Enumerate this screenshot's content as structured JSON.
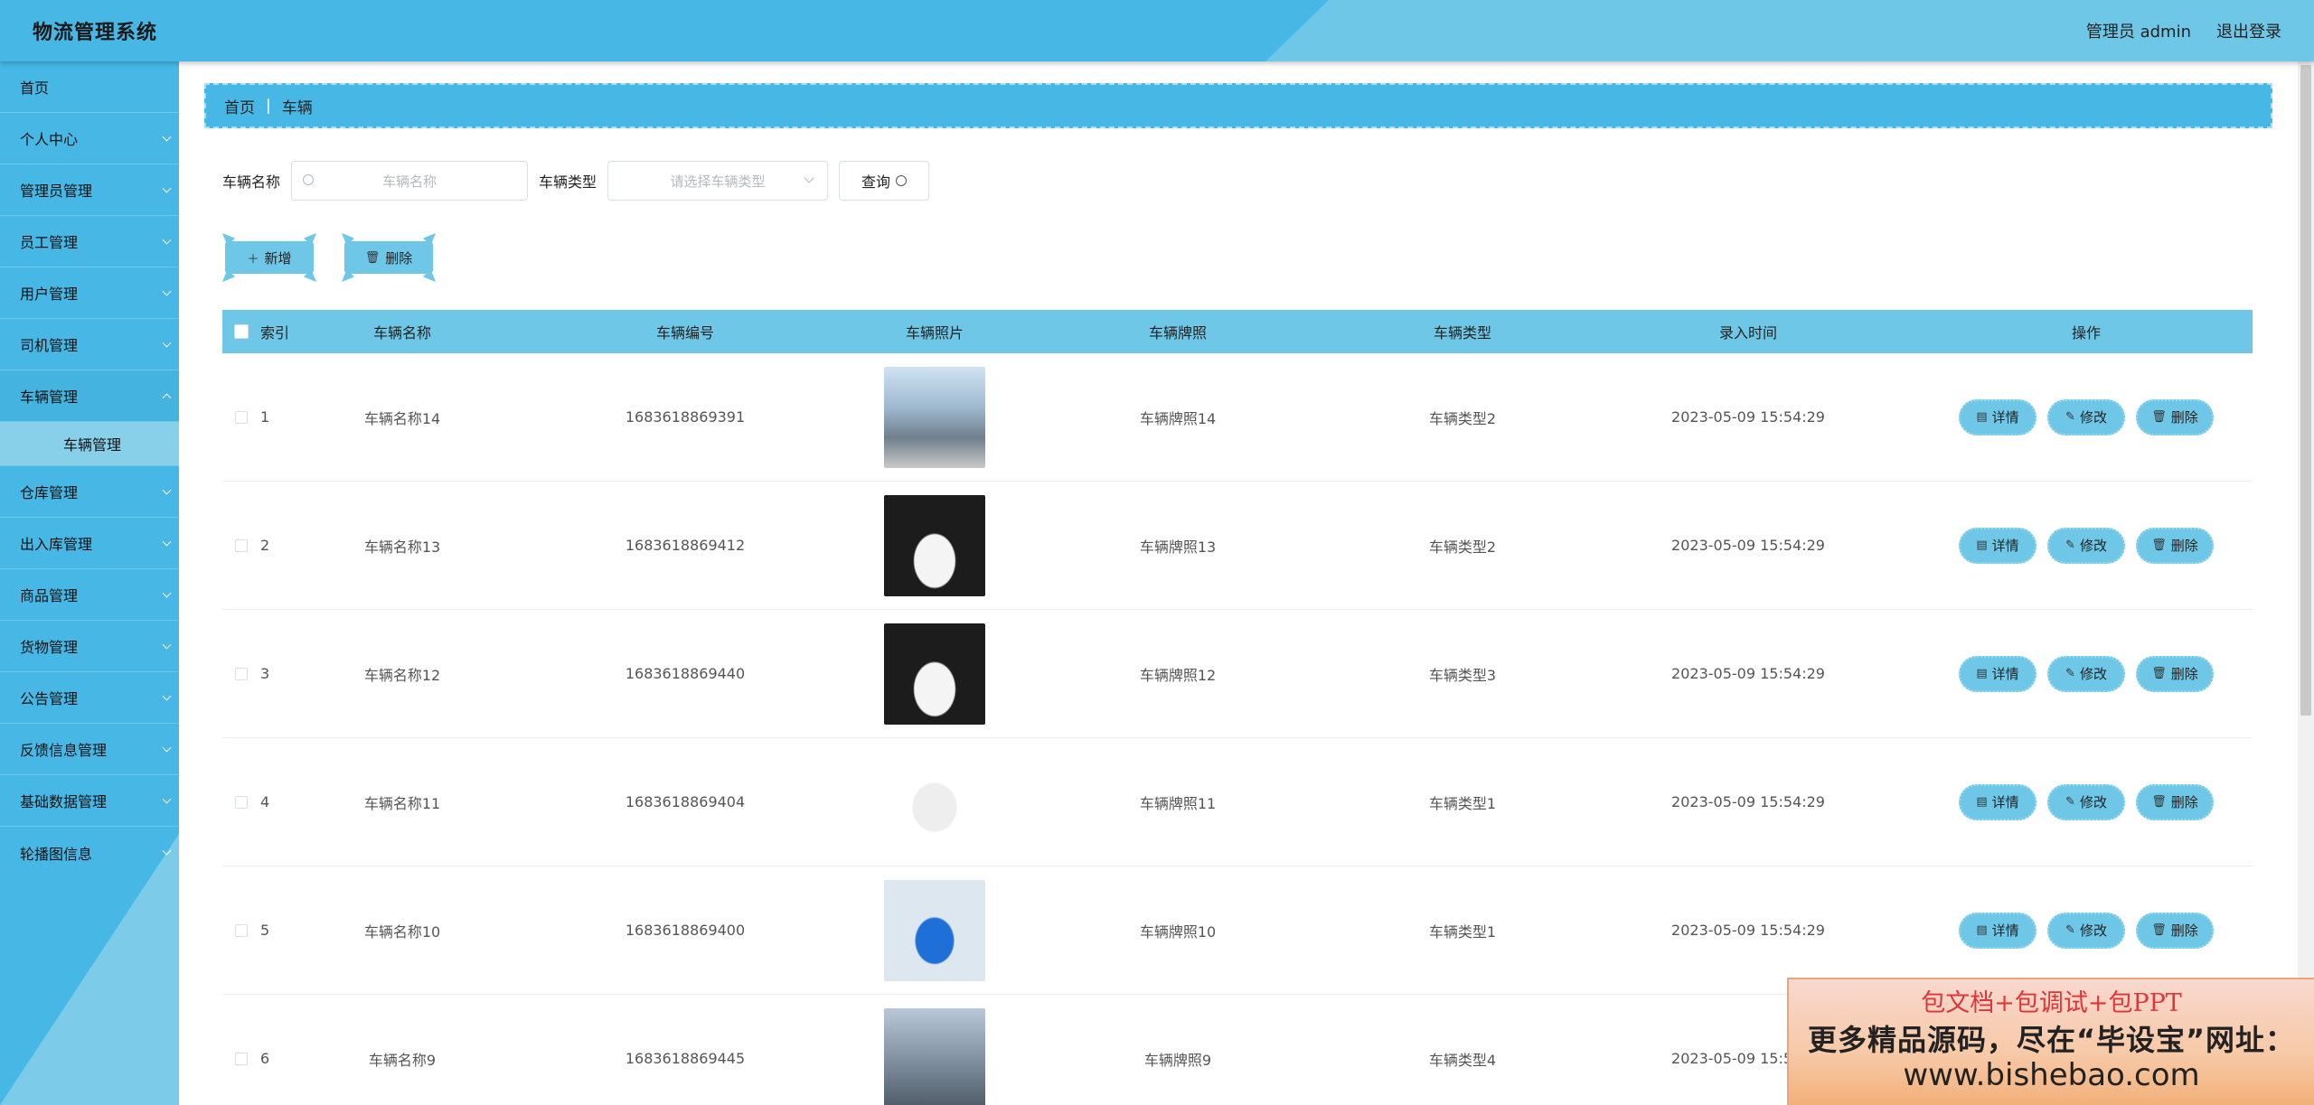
{
  "header": {
    "title": "物流管理系统",
    "user": "管理员 admin",
    "logout": "退出登录"
  },
  "sidebar": {
    "items": [
      {
        "label": "首页"
      },
      {
        "label": "个人中心"
      },
      {
        "label": "管理员管理"
      },
      {
        "label": "员工管理"
      },
      {
        "label": "用户管理"
      },
      {
        "label": "司机管理"
      },
      {
        "label": "车辆管理"
      },
      {
        "label": "仓库管理"
      },
      {
        "label": "出入库管理"
      },
      {
        "label": "商品管理"
      },
      {
        "label": "货物管理"
      },
      {
        "label": "公告管理"
      },
      {
        "label": "反馈信息管理"
      },
      {
        "label": "基础数据管理"
      },
      {
        "label": "轮播图信息"
      }
    ],
    "sub_item": "车辆管理"
  },
  "breadcrumb": {
    "home": "首页",
    "current": "车辆"
  },
  "search": {
    "name_label": "车辆名称",
    "name_placeholder": "车辆名称",
    "type_label": "车辆类型",
    "type_placeholder": "请选择车辆类型",
    "query_label": "查询"
  },
  "actions": {
    "add_label": "新增",
    "delete_label": "删除"
  },
  "table": {
    "headers": {
      "index": "索引",
      "name": "车辆名称",
      "number": "车辆编号",
      "photo": "车辆照片",
      "plate": "车辆牌照",
      "type": "车辆类型",
      "time": "录入时间",
      "ops": "操作"
    },
    "op_labels": {
      "detail": "详情",
      "edit": "修改",
      "delete": "删除"
    },
    "rows": [
      {
        "index": "1",
        "name": "车辆名称14",
        "number": "1683618869391",
        "plate": "车辆牌照14",
        "type": "车辆类型2",
        "time": "2023-05-09 15:54:29"
      },
      {
        "index": "2",
        "name": "车辆名称13",
        "number": "1683618869412",
        "plate": "车辆牌照13",
        "type": "车辆类型2",
        "time": "2023-05-09 15:54:29"
      },
      {
        "index": "3",
        "name": "车辆名称12",
        "number": "1683618869440",
        "plate": "车辆牌照12",
        "type": "车辆类型3",
        "time": "2023-05-09 15:54:29"
      },
      {
        "index": "4",
        "name": "车辆名称11",
        "number": "1683618869404",
        "plate": "车辆牌照11",
        "type": "车辆类型1",
        "time": "2023-05-09 15:54:29"
      },
      {
        "index": "5",
        "name": "车辆名称10",
        "number": "1683618869400",
        "plate": "车辆牌照10",
        "type": "车辆类型1",
        "time": "2023-05-09 15:54:29"
      },
      {
        "index": "6",
        "name": "车辆名称9",
        "number": "1683618869445",
        "plate": "车辆牌照9",
        "type": "车辆类型4",
        "time": "2023-05-09 15:54:29"
      }
    ]
  },
  "ad": {
    "line1": "包文档+包调试+包PPT",
    "line2": "更多精品源码，尽在“毕设宝”网址：",
    "line3": "www.bishebao.com"
  },
  "colors": {
    "header": "#47b8e6",
    "accent": "#6ec7e6"
  }
}
